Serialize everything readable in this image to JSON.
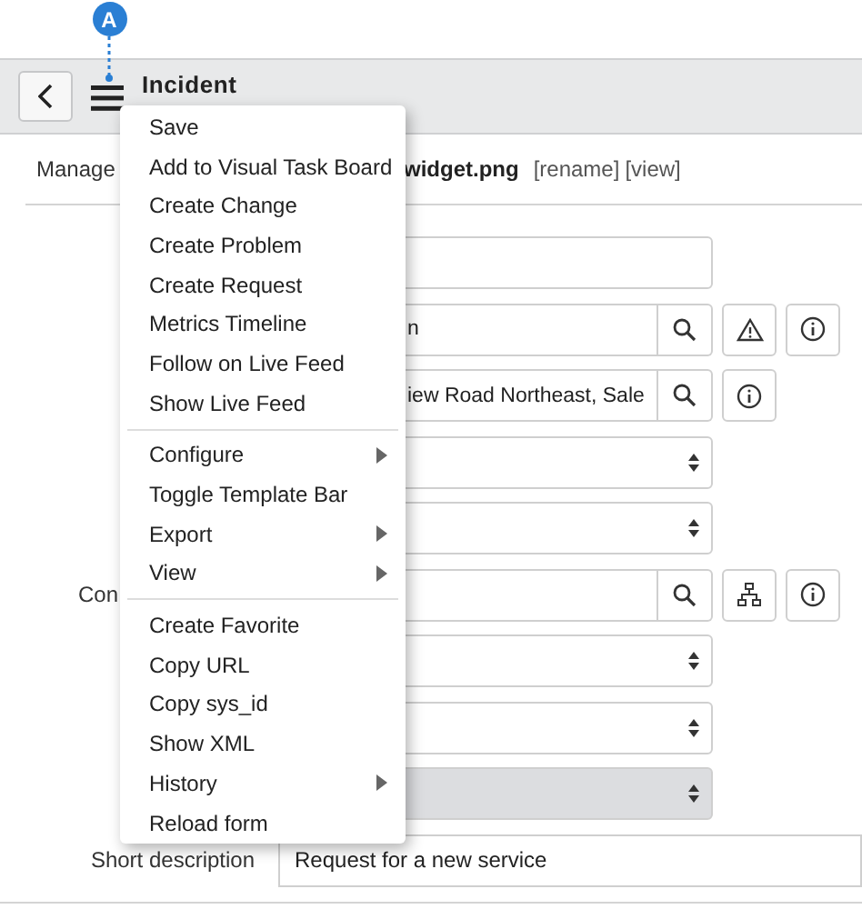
{
  "callout": {
    "label": "A"
  },
  "header": {
    "title": "Incident"
  },
  "attachments": {
    "label": "Manage",
    "file": "widget.png",
    "links": [
      "[rename]",
      "[view]"
    ]
  },
  "form": {
    "rows": [
      {
        "kind": "text"
      },
      {
        "kind": "reference",
        "value": "n",
        "buttons": [
          {
            "kind": "search"
          },
          {
            "kind": "warning"
          },
          {
            "kind": "info"
          }
        ]
      },
      {
        "kind": "reference",
        "value": "iew Road Northeast, Sale",
        "buttons": [
          {
            "kind": "search"
          },
          {
            "kind": "info"
          }
        ]
      },
      {
        "kind": "select",
        "disabled": false
      },
      {
        "kind": "select",
        "disabled": false
      },
      {
        "kind": "reference",
        "label": "Con",
        "buttons": [
          {
            "kind": "search"
          },
          {
            "kind": "hierarchy"
          },
          {
            "kind": "info"
          }
        ]
      },
      {
        "kind": "select",
        "disabled": false
      },
      {
        "kind": "select",
        "disabled": false
      },
      {
        "kind": "select",
        "disabled": true
      },
      {
        "kind": "text",
        "label": "Short description",
        "value": "Request for a new service"
      }
    ]
  },
  "menu": {
    "items": [
      {
        "kind": "item",
        "label": "Save"
      },
      {
        "kind": "item",
        "label": "Add to Visual Task Board"
      },
      {
        "kind": "item",
        "label": "Create Change"
      },
      {
        "kind": "item",
        "label": "Create Problem"
      },
      {
        "kind": "item",
        "label": "Create Request"
      },
      {
        "kind": "item",
        "label": "Metrics Timeline"
      },
      {
        "kind": "item",
        "label": "Follow on Live Feed"
      },
      {
        "kind": "item",
        "label": "Show Live Feed"
      },
      {
        "kind": "divider"
      },
      {
        "kind": "submenu",
        "label": "Configure"
      },
      {
        "kind": "item",
        "label": "Toggle Template Bar"
      },
      {
        "kind": "submenu",
        "label": "Export"
      },
      {
        "kind": "submenu",
        "label": "View"
      },
      {
        "kind": "divider"
      },
      {
        "kind": "item",
        "label": "Create Favorite"
      },
      {
        "kind": "item",
        "label": "Copy URL"
      },
      {
        "kind": "item",
        "label": "Copy sys_id"
      },
      {
        "kind": "item",
        "label": "Show XML"
      },
      {
        "kind": "submenu",
        "label": "History"
      },
      {
        "kind": "item",
        "label": "Reload form"
      }
    ]
  }
}
